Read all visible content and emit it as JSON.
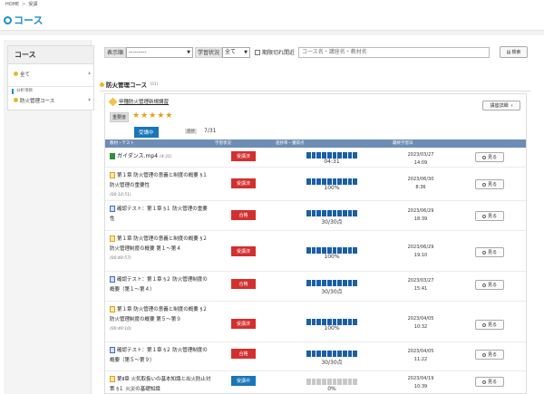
{
  "breadcrumb": {
    "home": "HOME",
    "current": "受講"
  },
  "page_title": "コース",
  "sidebar": {
    "heading": "コース",
    "items": [
      {
        "label": "全て"
      },
      {
        "section_label": "分析項目"
      },
      {
        "label": "防火管理コース"
      }
    ]
  },
  "filter": {
    "display_order_label": "表示順",
    "display_order_value": "---------",
    "study_status_label": "学習状況",
    "study_status_value": "全て",
    "deadline_label": "期限切れ間近",
    "search_placeholder": "コース名・講座名・教材名",
    "search_button": "検索"
  },
  "section": {
    "title": "防火管理コース",
    "count": "(01)"
  },
  "course": {
    "name": "甲種防火管理新規講習",
    "detail_button": "講座詳細",
    "importance_label": "重要度",
    "stars": "★★★★★",
    "status": "受講中",
    "progress_label": "進捗",
    "progress_value": "7/31"
  },
  "table_headers": {
    "material": "教材・テスト",
    "status": "学習状況",
    "progress": "進捗率・獲得点",
    "last_date": "最終学習日"
  },
  "rows": [
    {
      "title": "ガイダンス.mp4",
      "duration": "(4:31)",
      "status": "受講済",
      "progress": "04:31",
      "filled": 10,
      "date": "2023/03/27",
      "time": "14:09",
      "view": "見る"
    },
    {
      "title": "第１章 防火管理の意義と制度の概要 §１ 防火管理の重要性",
      "duration": "(00:10:51)",
      "status": "受講済",
      "progress": "100%",
      "filled": 10,
      "date": "2023/06/30",
      "time": "8:36",
      "view": "見る"
    },
    {
      "title": "確認テスト：第１章 §１ 防火管理の重要性",
      "duration": "",
      "status": "合格",
      "progress": "30/30点",
      "filled": 10,
      "date": "2023/06/29",
      "time": "18:39",
      "view": "見る"
    },
    {
      "title": "第１章 防火管理の意義と制度の概要 §２ 防火管理制度の概要 第１～第４",
      "duration": "(00:49:57)",
      "status": "受講済",
      "progress": "100%",
      "filled": 10,
      "date": "2023/06/29",
      "time": "19:10",
      "view": "見る"
    },
    {
      "title": "確認テスト：第１章 §２ 防火管理制度の概要（第１～第４）",
      "duration": "",
      "status": "合格",
      "progress": "30/30点",
      "filled": 10,
      "date": "2023/03/27",
      "time": "15:41",
      "view": "見る"
    },
    {
      "title": "第１章 防火管理の意義と制度の概要 §２ 防火管理制度の概要 第５～第９",
      "duration": "(00:49:10)",
      "status": "受講済",
      "progress": "100%",
      "filled": 10,
      "date": "2023/04/05",
      "time": "10:32",
      "view": "見る"
    },
    {
      "title": "確認テスト：第１章 §２ 防火管理制度の概要（第５～第９）",
      "duration": "",
      "status": "合格",
      "progress": "30/30点",
      "filled": 10,
      "date": "2023/04/05",
      "time": "11:22",
      "view": "見る"
    },
    {
      "title": "第Ⅱ章 火気取扱いの基本知識と出火防止対策 §１ 火災の基礎知識",
      "duration": "(00:22:14)",
      "status": "受講中",
      "progress": "0%",
      "filled": 0,
      "date": "2023/04/19",
      "time": "10:39",
      "view": "見る"
    }
  ]
}
